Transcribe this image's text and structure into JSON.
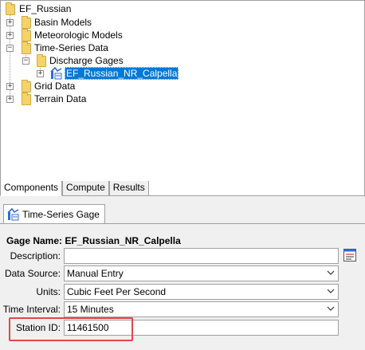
{
  "tree": {
    "root": "EF_Russian",
    "nodes": [
      {
        "label": "Basin Models"
      },
      {
        "label": "Meteorologic Models"
      },
      {
        "label": "Time-Series Data"
      },
      {
        "label": "Discharge Gages"
      },
      {
        "label": "EF_Russian_NR_Calpella"
      },
      {
        "label": "Grid Data"
      },
      {
        "label": "Terrain Data"
      }
    ]
  },
  "bottom_tabs": [
    "Components",
    "Compute",
    "Results"
  ],
  "editor": {
    "tab_label": "Time-Series Gage",
    "title": "Gage Name: EF_Russian_NR_Calpella",
    "fields": {
      "description": {
        "label": "Description:",
        "value": ""
      },
      "data_source": {
        "label": "Data Source:",
        "value": "Manual Entry"
      },
      "units": {
        "label": "Units:",
        "value": "Cubic Feet Per Second"
      },
      "time_interval": {
        "label": "Time Interval:",
        "value": "15 Minutes"
      },
      "station_id": {
        "label": "Station ID:",
        "value": "11461500"
      }
    }
  },
  "colors": {
    "selection": "#0078d7",
    "folder": "#f5d36b",
    "highlight": "#e04848"
  }
}
